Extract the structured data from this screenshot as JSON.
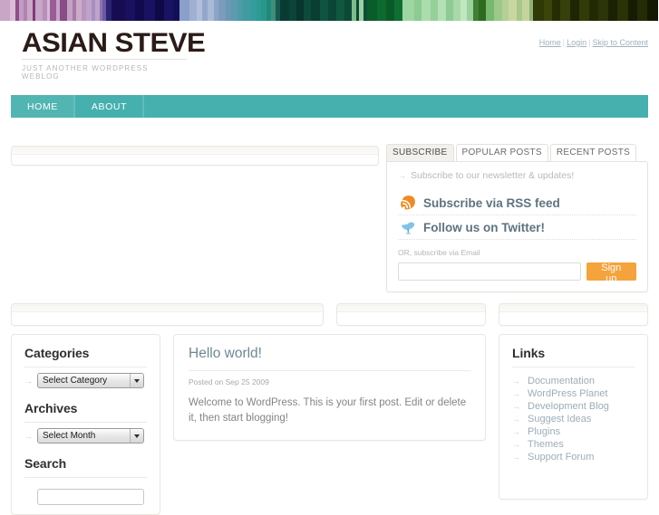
{
  "colorband": {
    "name": "decorative-stripe-band",
    "stripes": [
      {
        "w": 9,
        "c": "#c9a6c6"
      },
      {
        "w": 5,
        "c": "#d9bcd6"
      },
      {
        "w": 3,
        "c": "#8d4e8b"
      },
      {
        "w": 4,
        "c": "#c49cc2"
      },
      {
        "w": 3,
        "c": "#b183b0"
      },
      {
        "w": 5,
        "c": "#cba9c9"
      },
      {
        "w": 3,
        "c": "#7d3b7c"
      },
      {
        "w": 6,
        "c": "#c8a6c7"
      },
      {
        "w": 4,
        "c": "#b88fb8"
      },
      {
        "w": 3,
        "c": "#d5bbd4"
      },
      {
        "w": 5,
        "c": "#9a5c99"
      },
      {
        "w": 4,
        "c": "#c6a4c5"
      },
      {
        "w": 6,
        "c": "#8a4b89"
      },
      {
        "w": 5,
        "c": "#c3a1c2"
      },
      {
        "w": 3,
        "c": "#a87ba7"
      },
      {
        "w": 5,
        "c": "#ccabcb"
      },
      {
        "w": 4,
        "c": "#b895c0"
      },
      {
        "w": 5,
        "c": "#c0a3ca"
      },
      {
        "w": 3,
        "c": "#a98fc0"
      },
      {
        "w": 4,
        "c": "#bda4cc"
      },
      {
        "w": 3,
        "c": "#8f72ae"
      },
      {
        "w": 3,
        "c": "#6a5ba0"
      },
      {
        "w": 5,
        "c": "#2b2472"
      },
      {
        "w": 12,
        "c": "#150c52"
      },
      {
        "w": 9,
        "c": "#1a1060"
      },
      {
        "w": 8,
        "c": "#120a4d"
      },
      {
        "w": 10,
        "c": "#191262"
      },
      {
        "w": 8,
        "c": "#0f0a45"
      },
      {
        "w": 8,
        "c": "#1a1364"
      },
      {
        "w": 6,
        "c": "#111055"
      },
      {
        "w": 9,
        "c": "#8a9fc9"
      },
      {
        "w": 6,
        "c": "#9fb0d2"
      },
      {
        "w": 5,
        "c": "#b2bfd9"
      },
      {
        "w": 5,
        "c": "#93a6cb"
      },
      {
        "w": 6,
        "c": "#a9bcd6"
      },
      {
        "w": 4,
        "c": "#8ea4c8"
      },
      {
        "w": 6,
        "c": "#7b9cbd"
      },
      {
        "w": 5,
        "c": "#6b98b4"
      },
      {
        "w": 6,
        "c": "#5e9aaf"
      },
      {
        "w": 5,
        "c": "#4f9aa7"
      },
      {
        "w": 7,
        "c": "#3f9ba2"
      },
      {
        "w": 5,
        "c": "#349c9c"
      },
      {
        "w": 4,
        "c": "#2e9a94"
      },
      {
        "w": 5,
        "c": "#29968c"
      },
      {
        "w": 4,
        "c": "#1f8a7b"
      },
      {
        "w": 4,
        "c": "#3e8e7a"
      },
      {
        "w": 4,
        "c": "#17584f"
      },
      {
        "w": 8,
        "c": "#0a3b33"
      },
      {
        "w": 7,
        "c": "#0c443a"
      },
      {
        "w": 6,
        "c": "#08352d"
      },
      {
        "w": 7,
        "c": "#0d4a3c"
      },
      {
        "w": 8,
        "c": "#0a3e33"
      },
      {
        "w": 7,
        "c": "#0f5341"
      },
      {
        "w": 7,
        "c": "#0b4536"
      },
      {
        "w": 8,
        "c": "#10583f"
      },
      {
        "w": 6,
        "c": "#0b4a36"
      },
      {
        "w": 4,
        "c": "#7dbd8a"
      },
      {
        "w": 3,
        "c": "#0a4a33"
      },
      {
        "w": 4,
        "c": "#9ecfa6"
      },
      {
        "w": 3,
        "c": "#0b4f36"
      },
      {
        "w": 9,
        "c": "#0b5c2b"
      },
      {
        "w": 8,
        "c": "#0d6a2f"
      },
      {
        "w": 7,
        "c": "#0a5a27"
      },
      {
        "w": 8,
        "c": "#0f6f33"
      },
      {
        "w": 10,
        "c": "#9ed6a1"
      },
      {
        "w": 7,
        "c": "#8ccb92"
      },
      {
        "w": 8,
        "c": "#aadcac"
      },
      {
        "w": 6,
        "c": "#95d09a"
      },
      {
        "w": 8,
        "c": "#b4e0b5"
      },
      {
        "w": 6,
        "c": "#8ecb94"
      },
      {
        "w": 7,
        "c": "#a7d9a9"
      },
      {
        "w": 5,
        "c": "#c2e6c0"
      },
      {
        "w": 6,
        "c": "#9ad29e"
      },
      {
        "w": 5,
        "c": "#3f7e33"
      },
      {
        "w": 6,
        "c": "#2e6a1f"
      },
      {
        "w": 8,
        "c": "#76b86e"
      },
      {
        "w": 7,
        "c": "#9cc98a"
      },
      {
        "w": 6,
        "c": "#b4cf97"
      },
      {
        "w": 7,
        "c": "#c8d79f"
      },
      {
        "w": 5,
        "c": "#a9c68c"
      },
      {
        "w": 6,
        "c": "#c5d49b"
      },
      {
        "w": 4,
        "c": "#8fb277"
      },
      {
        "w": 9,
        "c": "#2f3807"
      },
      {
        "w": 8,
        "c": "#3b4409"
      },
      {
        "w": 7,
        "c": "#262d05"
      },
      {
        "w": 9,
        "c": "#35400a"
      },
      {
        "w": 8,
        "c": "#1e2504"
      },
      {
        "w": 9,
        "c": "#313b08"
      },
      {
        "w": 8,
        "c": "#222a05"
      },
      {
        "w": 9,
        "c": "#2c3507"
      },
      {
        "w": 8,
        "c": "#1a2104"
      },
      {
        "w": 10,
        "c": "#2a3206"
      },
      {
        "w": 8,
        "c": "#161c03"
      },
      {
        "w": 9,
        "c": "#252c05"
      },
      {
        "w": 10,
        "c": "#131803"
      }
    ]
  },
  "header": {
    "site_title": "ASIAN STEVE",
    "site_description": "JUST ANOTHER WORDPRESS WEBLOG",
    "toplinks": [
      {
        "label": "Home"
      },
      {
        "label": "Login"
      },
      {
        "label": "Skip to Content"
      }
    ],
    "separator": "|"
  },
  "nav": {
    "items": [
      {
        "label": "HOME",
        "current": true
      },
      {
        "label": "ABOUT",
        "current": false
      }
    ]
  },
  "subscribe": {
    "tabs": [
      {
        "label": "SUBSCRIBE",
        "active": true
      },
      {
        "label": "POPULAR POSTS",
        "active": false
      },
      {
        "label": "RECENT POSTS",
        "active": false
      }
    ],
    "tagline": "Subscribe to our newsletter & updates!",
    "arrow_glyph": "→",
    "rows": [
      {
        "icon": "rss-feed-icon",
        "label": "Subscribe via RSS feed"
      },
      {
        "icon": "twitter-bird-icon",
        "label": "Follow us on Twitter!"
      }
    ],
    "or_label": "OR, subscribe via Email",
    "email_value": "",
    "email_placeholder": "",
    "signup_label": "Sign up",
    "signup_color": "#f5a33c",
    "rss_color": "#f08a22",
    "twitter_color": "#7fc3e8"
  },
  "sidebar_left": {
    "categories": {
      "title": "Categories",
      "select_value": "Select Category"
    },
    "archives": {
      "title": "Archives",
      "select_value": "Select Month"
    },
    "search": {
      "title": "Search",
      "value": "",
      "placeholder": ""
    },
    "arrow_glyph": "→"
  },
  "post": {
    "title": "Hello world!",
    "meta": "Posted on Sep 25 2009",
    "body": "Welcome to WordPress. This is your first post. Edit or delete it, then start blogging!"
  },
  "sidebar_right": {
    "title": "Links",
    "arrow_glyph": "→",
    "items": [
      {
        "label": "Documentation"
      },
      {
        "label": "WordPress Planet"
      },
      {
        "label": "Development Blog"
      },
      {
        "label": "Suggest Ideas"
      },
      {
        "label": "Plugins"
      },
      {
        "label": "Themes"
      },
      {
        "label": "Support Forum"
      }
    ]
  },
  "empty_boxes": {
    "top_widget": "",
    "strip_one": "",
    "strip_two": "",
    "strip_three": ""
  },
  "theme": {
    "nav_teal": "#45b0ad",
    "accent_orange": "#f5a33c",
    "link_blue_grey": "#9cadb7",
    "heading_slate": "#6f8795"
  }
}
